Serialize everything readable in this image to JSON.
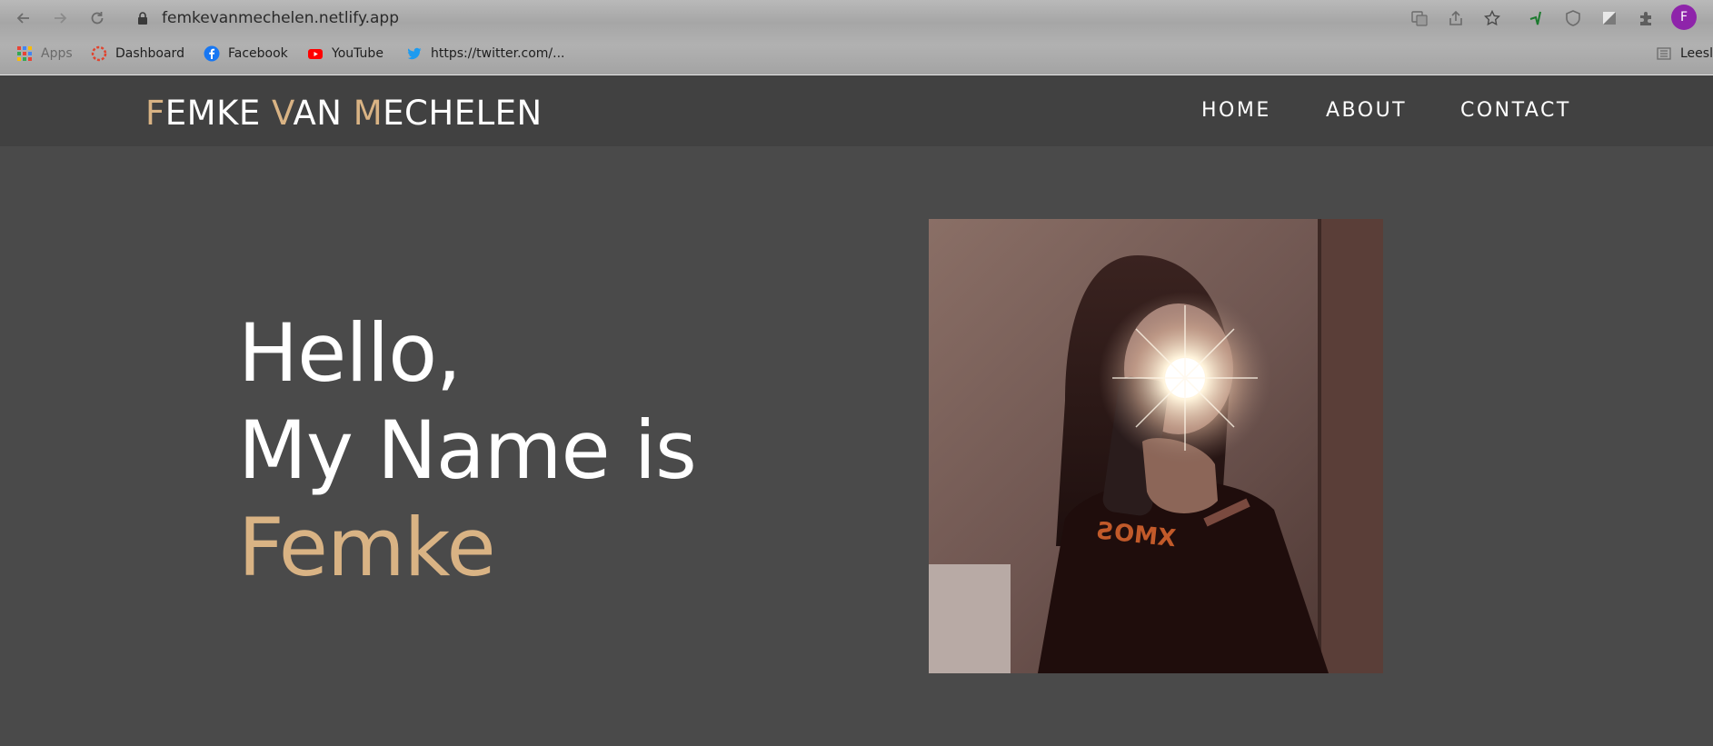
{
  "browser": {
    "url": "femkevanmechelen.netlify.app",
    "profile_initial": "F",
    "bookmarks": [
      {
        "label": "Apps",
        "icon": "apps-grid-icon"
      },
      {
        "label": "Dashboard",
        "icon": "dashboard-icon"
      },
      {
        "label": "Facebook",
        "icon": "facebook-icon"
      },
      {
        "label": "YouTube",
        "icon": "youtube-icon"
      },
      {
        "label": "https://twitter.com/...",
        "icon": "twitter-icon"
      }
    ],
    "reading_list": "Leesli"
  },
  "site": {
    "logo": {
      "first_initial": "F",
      "first_rest": "EMKE ",
      "second_initial": "V",
      "second_rest": "AN ",
      "third_initial": "M",
      "third_rest": "ECHELEN"
    },
    "nav": [
      "HOME",
      "ABOUT",
      "CONTACT"
    ],
    "hero": {
      "line1": "Hello,",
      "line2": "My Name is",
      "name": "Femke"
    }
  },
  "colors": {
    "accent": "#d9b384",
    "header_bg": "#414141",
    "page_bg": "#4a4a4a",
    "profile": "#8e24aa"
  }
}
